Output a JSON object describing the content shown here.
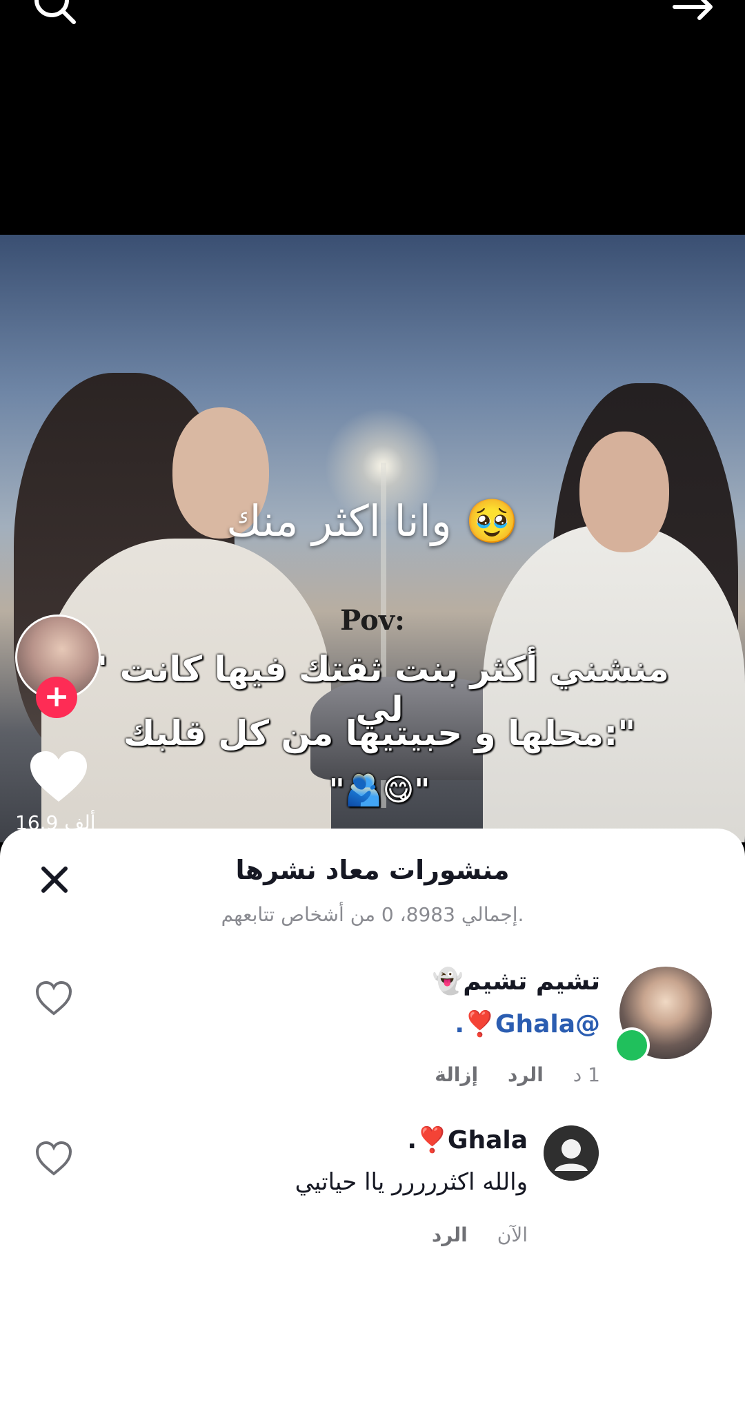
{
  "video": {
    "caption_main": "وانا اكثر منك 🥹",
    "pov": "Pov:",
    "quote_line1": "\" منشني أكثر بنت ثقتك فيها كانت لي",
    "quote_line2": "محلها و حبيتيها من كل قلبك:\"",
    "quote_line3": "\"🫂😋\"",
    "like_count": "16.9 ألف",
    "follow_symbol": "+"
  },
  "sheet": {
    "title": "منشورات معاد نشرها",
    "subtitle": "إجمالي 8983، 0 من أشخاص تتابعهم."
  },
  "comments": [
    {
      "author": "تشيم تشيم👻",
      "text": "@Ghala❣️.",
      "time": "1 د",
      "reply": "الرد",
      "remove": "إزالة"
    },
    {
      "author": "Ghala❣️.",
      "text": "والله اكثررررر ياا حياتيي",
      "time": "الآن",
      "reply": "الرد"
    }
  ],
  "icons": {
    "search": "search-icon",
    "share": "share-icon",
    "close": "close-icon",
    "like": "heart-icon"
  }
}
